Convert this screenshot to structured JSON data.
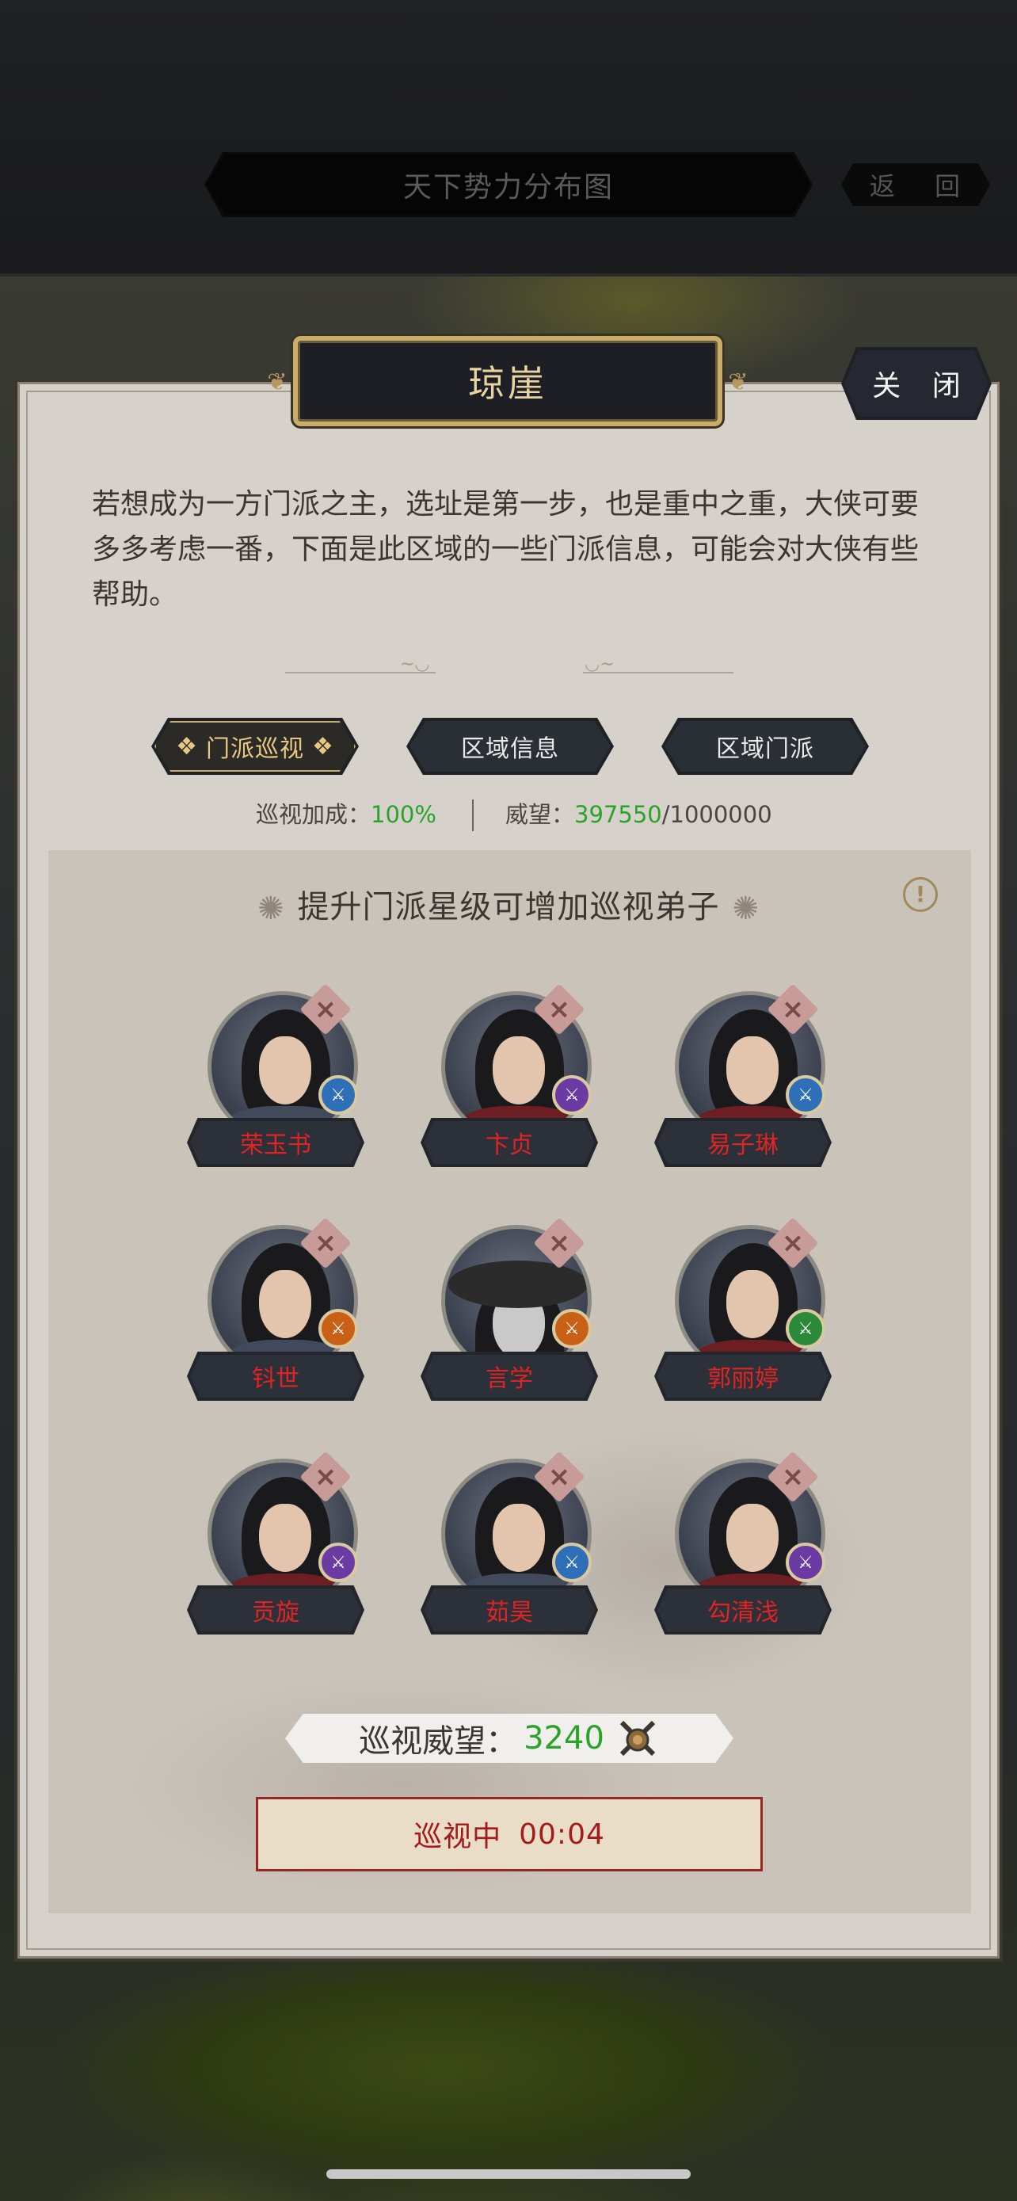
{
  "header": {
    "title": "天下势力分布图",
    "back_label": "返 回"
  },
  "panel": {
    "title": "琼崖",
    "close_label": "关 闭",
    "intro": "若想成为一方门派之主，选址是第一步，也是重中之重，大侠可要多多考虑一番，下面是此区域的一些门派信息，可能会对大侠有些帮助。",
    "tabs": [
      {
        "label": "门派巡视",
        "active": true
      },
      {
        "label": "区域信息",
        "active": false
      },
      {
        "label": "区域门派",
        "active": false
      }
    ],
    "stats": {
      "bonus_label": "巡视加成：",
      "bonus_value": "100%",
      "prestige_label": "威望：",
      "prestige_current": "397550",
      "prestige_max": "/1000000"
    },
    "section_title": "提升门派星级可增加巡视弟子",
    "disciples": [
      {
        "name": "荣玉书",
        "badge": "blue",
        "hair": "male"
      },
      {
        "name": "卞贞",
        "badge": "purple",
        "hair": "female"
      },
      {
        "name": "易子琳",
        "badge": "blue",
        "hair": "female"
      },
      {
        "name": "钭世",
        "badge": "orange",
        "hair": "male"
      },
      {
        "name": "言学",
        "badge": "orange",
        "hair": "hat"
      },
      {
        "name": "郭丽婷",
        "badge": "green",
        "hair": "female"
      },
      {
        "name": "贡旋",
        "badge": "purple",
        "hair": "female"
      },
      {
        "name": "茹昊",
        "badge": "blue",
        "hair": "male"
      },
      {
        "name": "勾清浅",
        "badge": "purple",
        "hair": "female"
      }
    ],
    "patrol_prestige_label": "巡视威望：",
    "patrol_prestige_value": "3240",
    "patrol_button_label": "巡视中",
    "patrol_button_time": "00:04"
  },
  "colors": {
    "accent_green": "#2aa32a",
    "name_red": "#e02424",
    "gold": "#c9ad6a"
  }
}
